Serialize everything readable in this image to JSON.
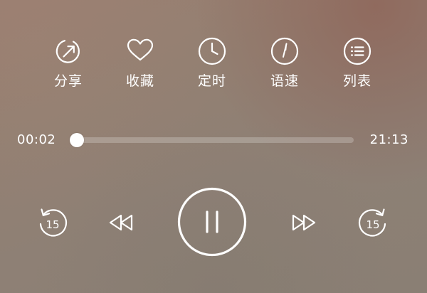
{
  "actions": [
    {
      "label": "分享",
      "icon": "share-icon"
    },
    {
      "label": "收藏",
      "icon": "heart-icon"
    },
    {
      "label": "定时",
      "icon": "clock-icon"
    },
    {
      "label": "语速",
      "icon": "speed-icon"
    },
    {
      "label": "列表",
      "icon": "list-icon"
    }
  ],
  "progress": {
    "elapsed": "00:02",
    "total": "21:13",
    "fraction": 0.002
  },
  "controls": {
    "skip_back_seconds": "15",
    "skip_forward_seconds": "15",
    "state": "playing"
  },
  "colors": {
    "foreground": "#ffffff"
  }
}
